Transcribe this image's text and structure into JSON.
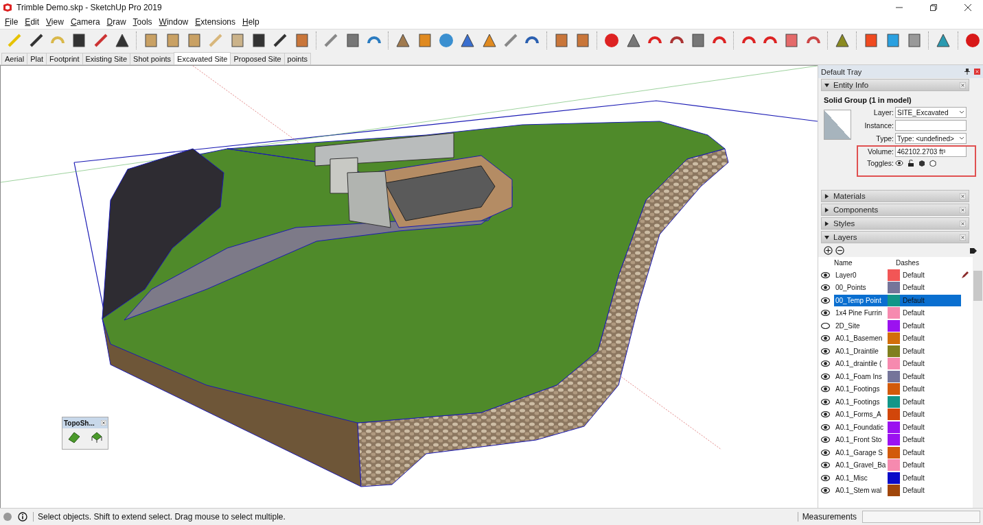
{
  "window": {
    "title": "Trimble Demo.skp - SketchUp Pro 2019"
  },
  "menu": [
    "File",
    "Edit",
    "View",
    "Camera",
    "Draw",
    "Tools",
    "Window",
    "Extensions",
    "Help"
  ],
  "scene_tabs": [
    {
      "label": "Aerial",
      "selected": false
    },
    {
      "label": "Plat",
      "selected": false
    },
    {
      "label": "Footprint",
      "selected": false
    },
    {
      "label": "Existing Site",
      "selected": false
    },
    {
      "label": "Shot points",
      "selected": false
    },
    {
      "label": "Excavated Site",
      "selected": true
    },
    {
      "label": "Proposed Site",
      "selected": false
    },
    {
      "label": "points",
      "selected": false
    }
  ],
  "floating_toolbar": {
    "title": "TopoSh..."
  },
  "tray": {
    "title": "Default Tray",
    "entity_info": {
      "title": "Entity Info",
      "expanded": true,
      "heading": "Solid Group (1 in model)",
      "fields": [
        {
          "label": "Layer:",
          "value": "SITE_Excavated",
          "kind": "dropdown"
        },
        {
          "label": "Instance:",
          "kind": "input"
        },
        {
          "label": "Type:",
          "value": "Type: <undefined>",
          "kind": "dropdown"
        },
        {
          "label": "Volume:",
          "value": "462102.2703 ft³",
          "kind": "readout"
        }
      ],
      "toggles_label": "Toggles:"
    },
    "panels": [
      {
        "title": "Materials",
        "expanded": false
      },
      {
        "title": "Components",
        "expanded": false
      },
      {
        "title": "Styles",
        "expanded": false
      },
      {
        "title": "Layers",
        "expanded": true
      }
    ],
    "layers": {
      "columns": [
        "Name",
        "Dashes"
      ],
      "rows": [
        {
          "name": "Layer0",
          "color": "#f25656",
          "dashes": "Default",
          "visible": true,
          "selected": false,
          "current": true
        },
        {
          "name": "00_Points",
          "color": "#75759a",
          "dashes": "Default",
          "visible": true,
          "selected": false,
          "current": false
        },
        {
          "name": "00_Temp Point",
          "color": "#129688",
          "dashes": "Default",
          "visible": true,
          "selected": true,
          "current": false
        },
        {
          "name": "1x4 Pine Furrin",
          "color": "#f68aaf",
          "dashes": "Default",
          "visible": true,
          "selected": false,
          "current": false
        },
        {
          "name": "2D_Site",
          "color": "#9b12f0",
          "dashes": "Default",
          "visible": false,
          "selected": false,
          "current": false
        },
        {
          "name": "A0.1_Basemen",
          "color": "#d26e0a",
          "dashes": "Default",
          "visible": true,
          "selected": false,
          "current": false
        },
        {
          "name": "A0.1_Draintile",
          "color": "#7f7f1e",
          "dashes": "Default",
          "visible": true,
          "selected": false,
          "current": false
        },
        {
          "name": "A0.1_draintile (",
          "color": "#f68aaf",
          "dashes": "Default",
          "visible": true,
          "selected": false,
          "current": false
        },
        {
          "name": "A0.1_Foam Ins",
          "color": "#75759a",
          "dashes": "Default",
          "visible": true,
          "selected": false,
          "current": false
        },
        {
          "name": "A0.1_Footings",
          "color": "#d25a0a",
          "dashes": "Default",
          "visible": true,
          "selected": false,
          "current": false
        },
        {
          "name": "A0.1_Footings",
          "color": "#129688",
          "dashes": "Default",
          "visible": true,
          "selected": false,
          "current": false
        },
        {
          "name": "A0.1_Forms_A",
          "color": "#d2460a",
          "dashes": "Default",
          "visible": true,
          "selected": false,
          "current": false
        },
        {
          "name": "A0.1_Foundatic",
          "color": "#9b12f0",
          "dashes": "Default",
          "visible": true,
          "selected": false,
          "current": false
        },
        {
          "name": "A0.1_Front Sto",
          "color": "#9b12f0",
          "dashes": "Default",
          "visible": true,
          "selected": false,
          "current": false
        },
        {
          "name": "A0.1_Garage S",
          "color": "#d25a0a",
          "dashes": "Default",
          "visible": true,
          "selected": false,
          "current": false
        },
        {
          "name": "A0.1_Gravel_Ba",
          "color": "#f68aaf",
          "dashes": "Default",
          "visible": true,
          "selected": false,
          "current": false
        },
        {
          "name": "A0.1_Misc",
          "color": "#0a0ac8",
          "dashes": "Default",
          "visible": true,
          "selected": false,
          "current": false
        },
        {
          "name": "A0.1_Stem wal",
          "color": "#a0460a",
          "dashes": "Default",
          "visible": true,
          "selected": false,
          "current": false
        }
      ]
    }
  },
  "status_bar": {
    "message": "Select objects. Shift to extend select. Drag mouse to select multiple.",
    "measurements_label": "Measurements"
  }
}
